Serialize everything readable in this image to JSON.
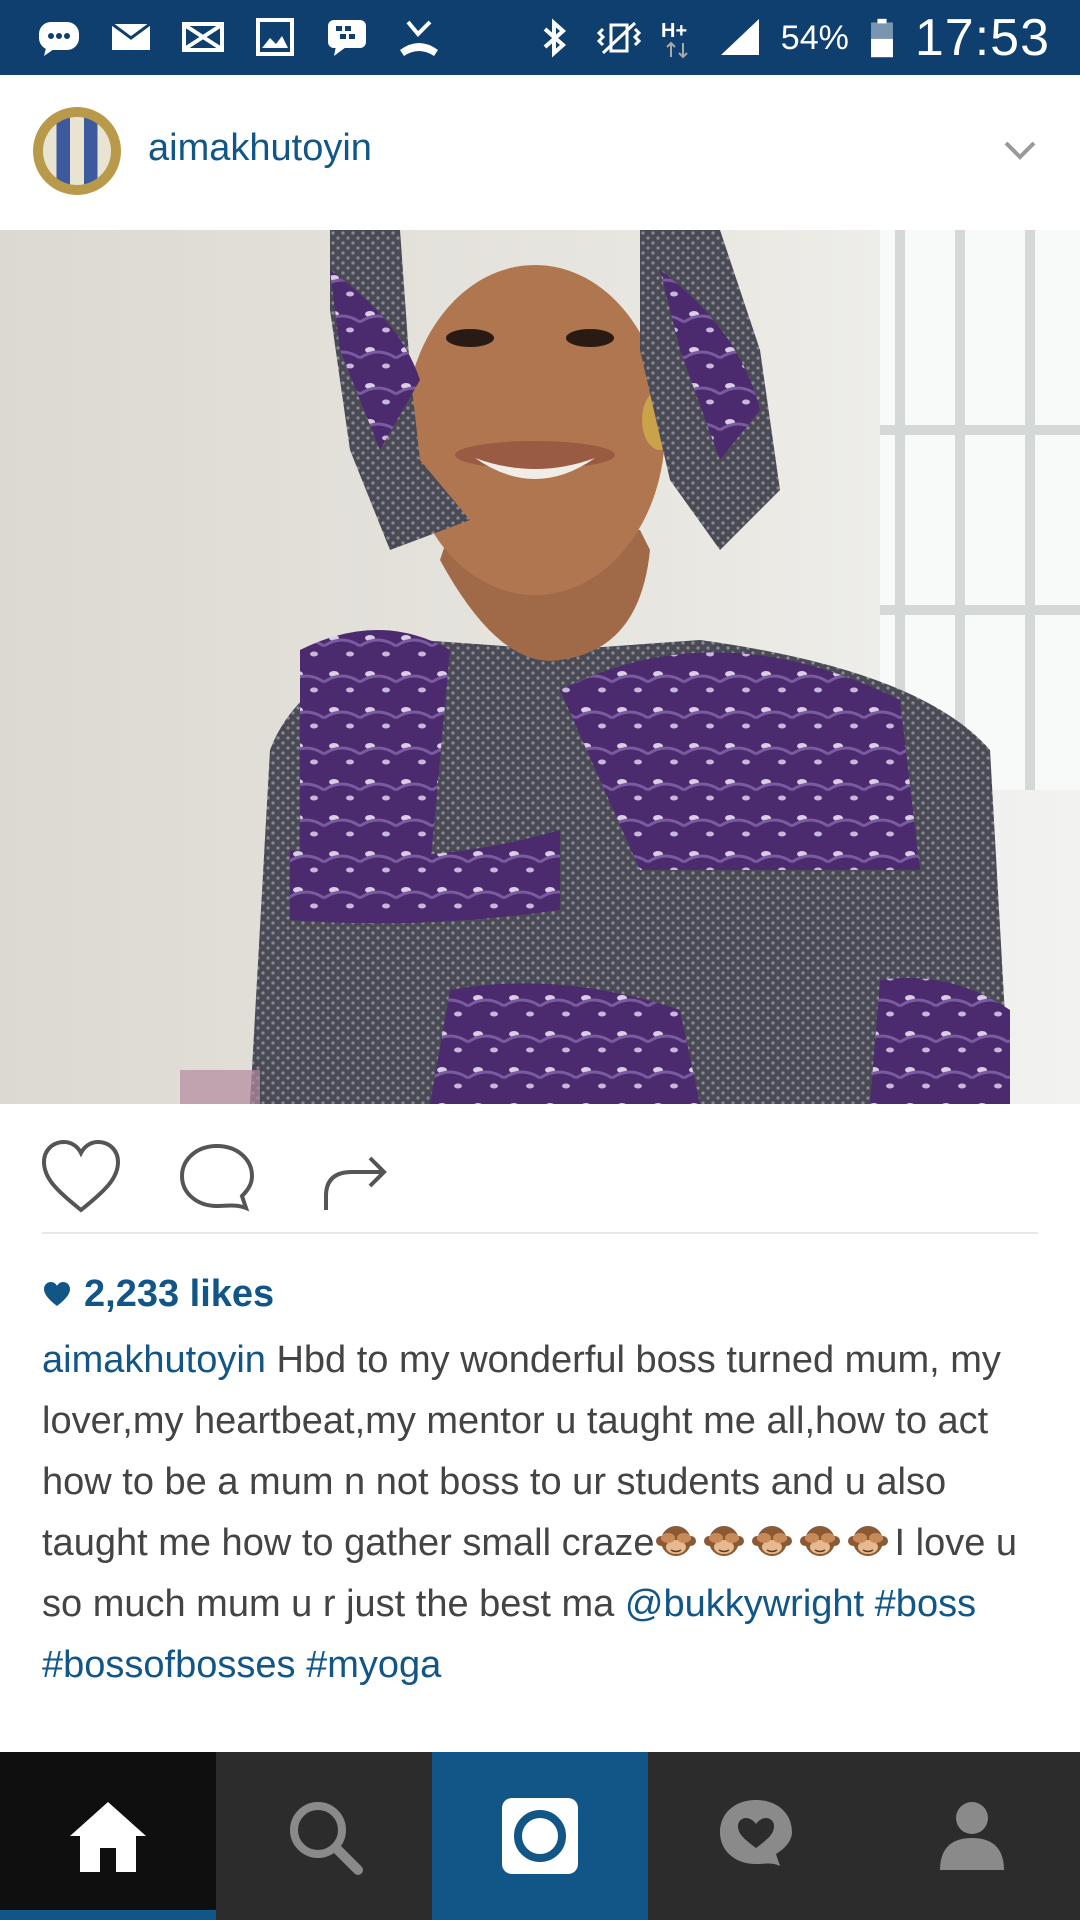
{
  "status_bar": {
    "battery": "54%",
    "time": "17:53",
    "network": "H+",
    "icons": [
      "chat-bubble-icon",
      "mail-icon",
      "mail-crossed-icon",
      "gallery-icon",
      "bbm-icon",
      "missed-call-icon",
      "bluetooth-icon",
      "vibrate-icon",
      "signal-icon",
      "battery-icon"
    ]
  },
  "post": {
    "username": "aimakhutoyin",
    "likes": "2,233 likes",
    "caption": {
      "author": "aimakhutoyin",
      "text_1": "Hbd to my wonderful boss turned mum, my lover,my heartbeat,my mentor u taught me all,how to act how to be a mum n not boss to ur students and u also taught me how to gather small craze",
      "emoji": "see-no-evil-monkey",
      "emoji_count": 5,
      "text_2": "I love u so much mum u r just the best ma",
      "mention": "@bukkywright",
      "hashtags": [
        "#boss",
        "#bossofbosses",
        "#myoga"
      ]
    }
  },
  "actions": [
    "like-button",
    "comment-button",
    "share-button"
  ],
  "bottom_nav": [
    "home",
    "search",
    "camera",
    "activity",
    "profile"
  ],
  "colors": {
    "status_bar": "#0e3f6e",
    "link": "#125688",
    "nav_bg": "#262626",
    "nav_active": "#125688"
  }
}
